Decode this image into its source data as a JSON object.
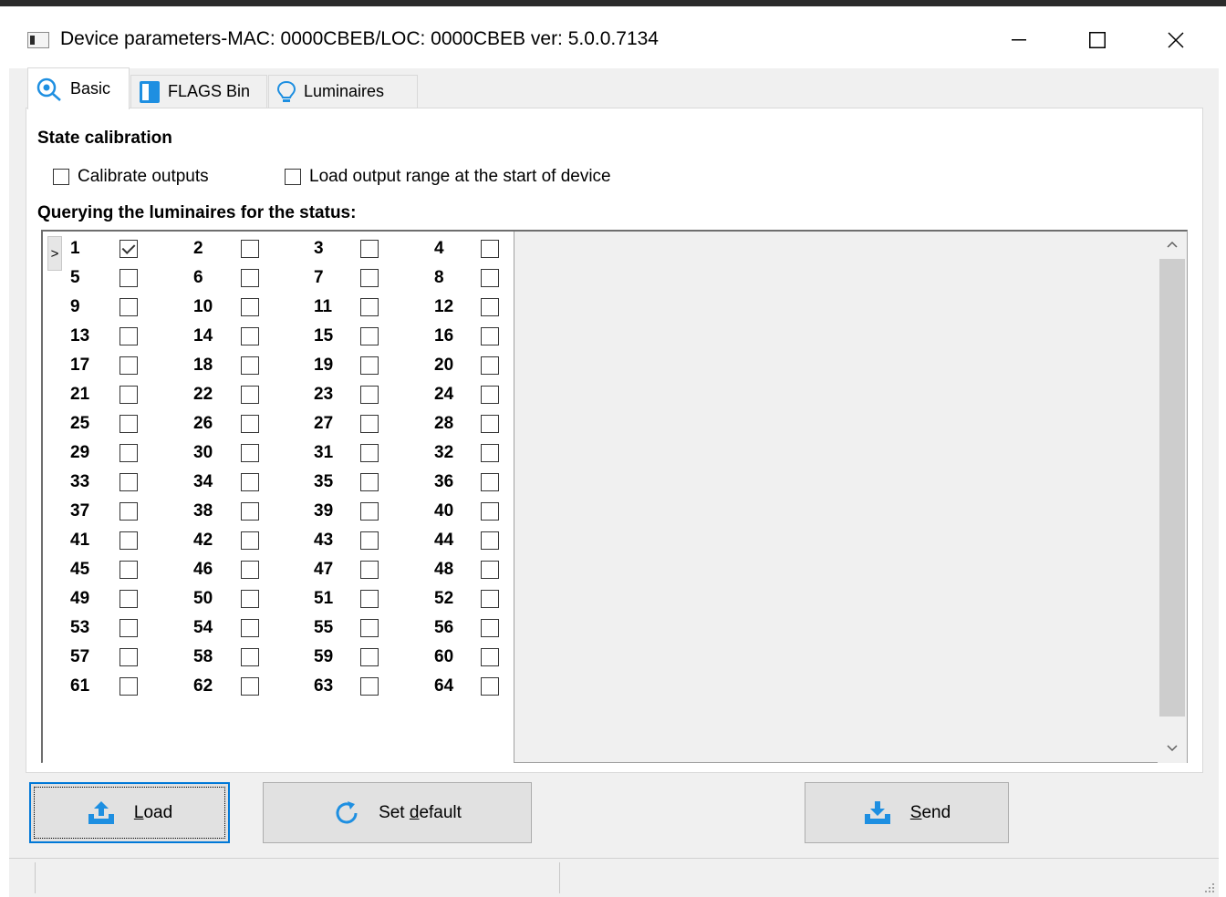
{
  "window": {
    "title": "Device parameters-MAC: 0000CBEB/LOC: 0000CBEB ver: 5.0.0.7134",
    "controls": [
      "minimize",
      "maximize",
      "close"
    ]
  },
  "tabs": [
    {
      "label": "Basic",
      "icon": "basic-settings-icon",
      "active": true
    },
    {
      "label": "FLAGS Bin",
      "icon": "flags-icon",
      "active": false
    },
    {
      "label": "Luminaires",
      "icon": "bulb-icon",
      "active": false
    }
  ],
  "state_calibration": {
    "heading": "State calibration",
    "calibrate_outputs": {
      "label": "Calibrate outputs",
      "checked": false
    },
    "load_output_range": {
      "label": "Load output range at the start of device",
      "checked": false
    }
  },
  "querying": {
    "heading": "Querying the luminaires for the status:",
    "row_indicator": ">",
    "luminaires": [
      {
        "num": "1",
        "checked": true
      },
      {
        "num": "2",
        "checked": false
      },
      {
        "num": "3",
        "checked": false
      },
      {
        "num": "4",
        "checked": false
      },
      {
        "num": "5",
        "checked": false
      },
      {
        "num": "6",
        "checked": false
      },
      {
        "num": "7",
        "checked": false
      },
      {
        "num": "8",
        "checked": false
      },
      {
        "num": "9",
        "checked": false
      },
      {
        "num": "10",
        "checked": false
      },
      {
        "num": "11",
        "checked": false
      },
      {
        "num": "12",
        "checked": false
      },
      {
        "num": "13",
        "checked": false
      },
      {
        "num": "14",
        "checked": false
      },
      {
        "num": "15",
        "checked": false
      },
      {
        "num": "16",
        "checked": false
      },
      {
        "num": "17",
        "checked": false
      },
      {
        "num": "18",
        "checked": false
      },
      {
        "num": "19",
        "checked": false
      },
      {
        "num": "20",
        "checked": false
      },
      {
        "num": "21",
        "checked": false
      },
      {
        "num": "22",
        "checked": false
      },
      {
        "num": "23",
        "checked": false
      },
      {
        "num": "24",
        "checked": false
      },
      {
        "num": "25",
        "checked": false
      },
      {
        "num": "26",
        "checked": false
      },
      {
        "num": "27",
        "checked": false
      },
      {
        "num": "28",
        "checked": false
      },
      {
        "num": "29",
        "checked": false
      },
      {
        "num": "30",
        "checked": false
      },
      {
        "num": "31",
        "checked": false
      },
      {
        "num": "32",
        "checked": false
      },
      {
        "num": "33",
        "checked": false
      },
      {
        "num": "34",
        "checked": false
      },
      {
        "num": "35",
        "checked": false
      },
      {
        "num": "36",
        "checked": false
      },
      {
        "num": "37",
        "checked": false
      },
      {
        "num": "38",
        "checked": false
      },
      {
        "num": "39",
        "checked": false
      },
      {
        "num": "40",
        "checked": false
      },
      {
        "num": "41",
        "checked": false
      },
      {
        "num": "42",
        "checked": false
      },
      {
        "num": "43",
        "checked": false
      },
      {
        "num": "44",
        "checked": false
      },
      {
        "num": "45",
        "checked": false
      },
      {
        "num": "46",
        "checked": false
      },
      {
        "num": "47",
        "checked": false
      },
      {
        "num": "48",
        "checked": false
      },
      {
        "num": "49",
        "checked": false
      },
      {
        "num": "50",
        "checked": false
      },
      {
        "num": "51",
        "checked": false
      },
      {
        "num": "52",
        "checked": false
      },
      {
        "num": "53",
        "checked": false
      },
      {
        "num": "54",
        "checked": false
      },
      {
        "num": "55",
        "checked": false
      },
      {
        "num": "56",
        "checked": false
      },
      {
        "num": "57",
        "checked": false
      },
      {
        "num": "58",
        "checked": false
      },
      {
        "num": "59",
        "checked": false
      },
      {
        "num": "60",
        "checked": false
      },
      {
        "num": "61",
        "checked": false
      },
      {
        "num": "62",
        "checked": false
      },
      {
        "num": "63",
        "checked": false
      },
      {
        "num": "64",
        "checked": false
      }
    ]
  },
  "buttons": {
    "load": {
      "label": "Load",
      "icon": "upload-icon"
    },
    "set_default": {
      "label": "Set default",
      "icon": "refresh-icon"
    },
    "send": {
      "label": "Send",
      "icon": "download-icon"
    }
  },
  "colors": {
    "accent": "#0078d7",
    "icon_blue": "#1e8fe1",
    "window_bg": "#f0f0f0"
  }
}
